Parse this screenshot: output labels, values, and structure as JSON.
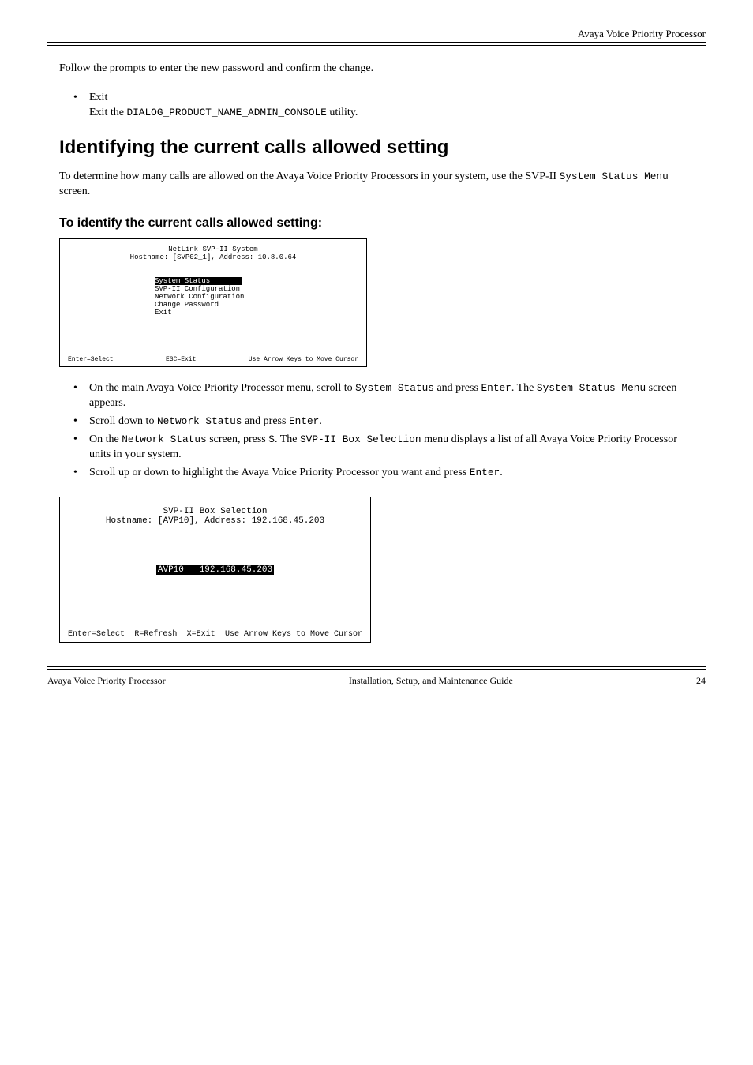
{
  "header": {
    "right": "Avaya Voice Priority Processor"
  },
  "intro": "Follow the prompts to enter the new password and confirm the change.",
  "exit": {
    "bullet_label": "Exit",
    "desc_prefix": "Exit the ",
    "desc_code": "DIALOG_PRODUCT_NAME_ADMIN_CONSOLE",
    "desc_suffix": " utility."
  },
  "section": {
    "title": "Identifying the current calls allowed setting",
    "para_pre": "To determine how many calls are allowed on the Avaya Voice Priority Processors in your system, use the SVP-II ",
    "para_code": "System Status Menu",
    "para_post": "screen.",
    "step1": "To identify the current calls allowed setting:"
  },
  "term1": {
    "title": "NetLink SVP-II System",
    "host": "Hostname: [SVP02_1], Address: 10.8.0.64",
    "menu": [
      {
        "label": "System Status",
        "selected": true
      },
      {
        "label": "SVP-II Configuration",
        "selected": false
      },
      {
        "label": "Network Configuration",
        "selected": false
      },
      {
        "label": "Change Password",
        "selected": false
      },
      {
        "label": "Exit",
        "selected": false
      }
    ],
    "foot1": "Enter=Select",
    "foot2": "ESC=Exit",
    "foot3": "Use Arrow Keys to Move Cursor"
  },
  "steps": [
    {
      "pre": "On the main Avaya Voice Priority Processor menu, scroll to ",
      "code": "System Status",
      "post1": " and press ",
      "code2": "Enter",
      "post2": ". The ",
      "code3": "System Status Menu",
      "post3": " screen appears."
    },
    {
      "pre": "Scroll down to ",
      "code": "Network Status",
      "post1": " and press ",
      "code2": "Enter",
      "post2": "."
    },
    {
      "pre": "On the ",
      "code": "Network Status",
      "post1": " screen, press ",
      "code2": "S",
      "post2": ". The ",
      "code3": "SVP-II Box Selection",
      "post3": " menu displays a list of all Avaya Voice Priority Processor units in your system."
    },
    {
      "pre": "Scroll up or down to highlight the Avaya Voice Priority Processor you want and press ",
      "code": "Enter",
      "post1": "."
    }
  ],
  "term2": {
    "title": "SVP-II Box Selection",
    "host": "Hostname: [AVP10], Address: 192.168.45.203",
    "sel_name": "AVP10",
    "sel_ip": "192.168.45.203",
    "foot1": "Enter=Select",
    "foot2": "R=Refresh",
    "foot3": "X=Exit",
    "foot4": "Use Arrow Keys to Move Cursor"
  },
  "footer": {
    "left": "Avaya Voice Priority Processor",
    "center": "Installation, Setup, and Maintenance Guide",
    "right": "24"
  }
}
